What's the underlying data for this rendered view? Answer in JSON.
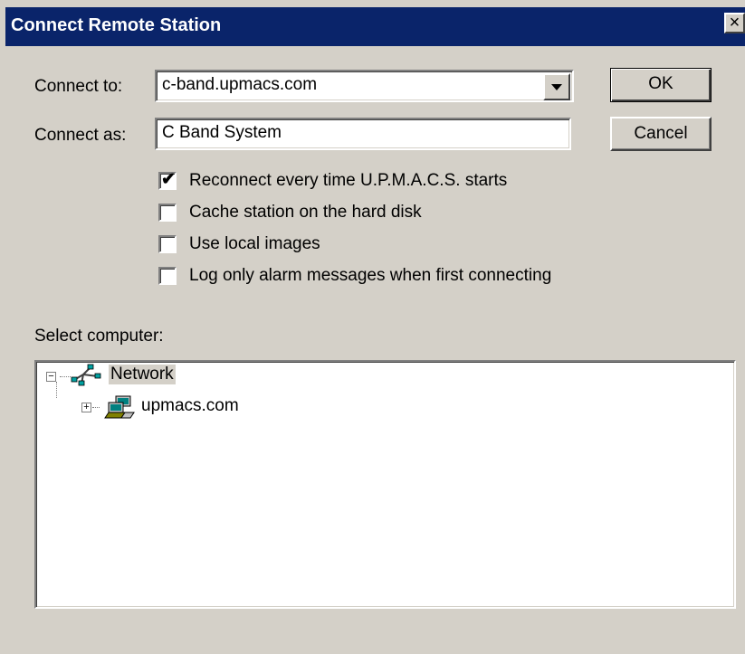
{
  "window": {
    "title": "Connect Remote Station",
    "close_glyph": "×"
  },
  "form": {
    "connect_to_label": "Connect to:",
    "connect_to_value": "c-band.upmacs.com",
    "connect_as_label": "Connect as:",
    "connect_as_value": "C Band System"
  },
  "buttons": {
    "ok": "OK",
    "cancel": "Cancel"
  },
  "options": [
    {
      "label": "Reconnect every time U.P.M.A.C.S. starts",
      "checked": true
    },
    {
      "label": "Cache station on the hard disk",
      "checked": false
    },
    {
      "label": "Use local images",
      "checked": false
    },
    {
      "label": "Log only alarm messages when first connecting",
      "checked": false
    }
  ],
  "tree": {
    "label": "Select computer:",
    "nodes": [
      {
        "label": "Network",
        "icon": "network-icon",
        "expander": "−",
        "selected": true
      },
      {
        "label": "upmacs.com",
        "icon": "domain-computers-icon",
        "expander": "+",
        "selected": false
      }
    ]
  },
  "colors": {
    "titlebar": "#0a246a",
    "dialog_face": "#d4d0c8"
  }
}
